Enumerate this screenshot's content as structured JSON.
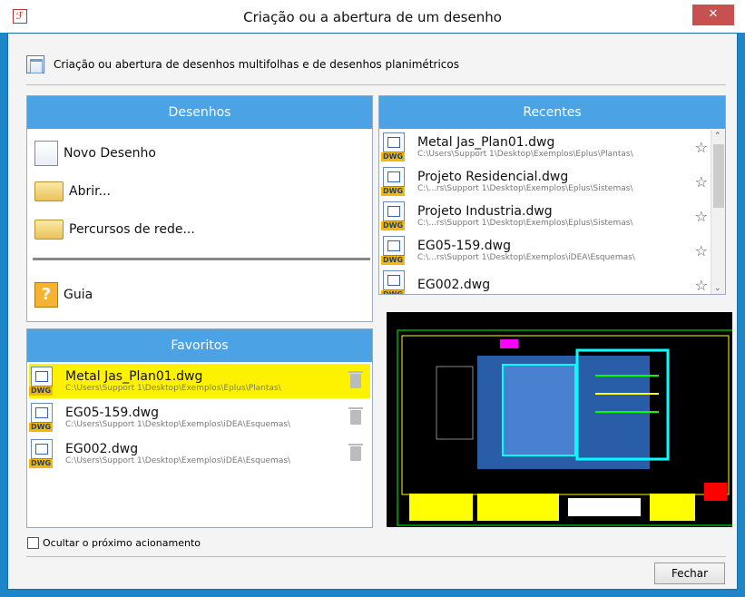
{
  "window": {
    "title": "Criação ou a abertura de um desenho",
    "close_glyph": "✕"
  },
  "header": {
    "text": "Criação ou abertura de desenhos multifolhas e de desenhos planimétricos"
  },
  "drawings": {
    "heading": "Desenhos",
    "new": "Novo Desenho",
    "open": "Abrir...",
    "network": "Percursos de rede...",
    "guide": "Guia"
  },
  "favorites": {
    "heading": "Favoritos",
    "items": [
      {
        "name": "Metal Jas_Plan01.dwg",
        "path": "C:\\Users\\Support 1\\Desktop\\Exemplos\\Eplus\\Plantas\\"
      },
      {
        "name": "EG05-159.dwg",
        "path": "C:\\Users\\Support 1\\Desktop\\Exemplos\\iDEA\\Esquemas\\"
      },
      {
        "name": "EG002.dwg",
        "path": "C:\\Users\\Support 1\\Desktop\\Exemplos\\iDEA\\Esquemas\\"
      }
    ]
  },
  "recent": {
    "heading": "Recentes",
    "items": [
      {
        "name": "Metal Jas_Plan01.dwg",
        "path": "C:\\Users\\Support 1\\Desktop\\Exemplos\\Eplus\\Plantas\\"
      },
      {
        "name": "Projeto Residencial.dwg",
        "path": "C:\\...rs\\Support 1\\Desktop\\Exemplos\\Eplus\\Sistemas\\"
      },
      {
        "name": "Projeto Industria.dwg",
        "path": "C:\\...rs\\Support 1\\Desktop\\Exemplos\\Eplus\\Sistemas\\"
      },
      {
        "name": "EG05-159.dwg",
        "path": "C:\\...rs\\Support 1\\Desktop\\Exemplos\\iDEA\\Esquemas\\"
      },
      {
        "name": "EG002.dwg",
        "path": ""
      }
    ]
  },
  "icon_tag": "DWG",
  "footer": {
    "checkbox_label": "Ocultar o próximo acionamento",
    "close_button": "Fechar"
  },
  "colors": {
    "accent": "#4ba3e6",
    "highlight": "#fff200",
    "title_close": "#c75050"
  }
}
